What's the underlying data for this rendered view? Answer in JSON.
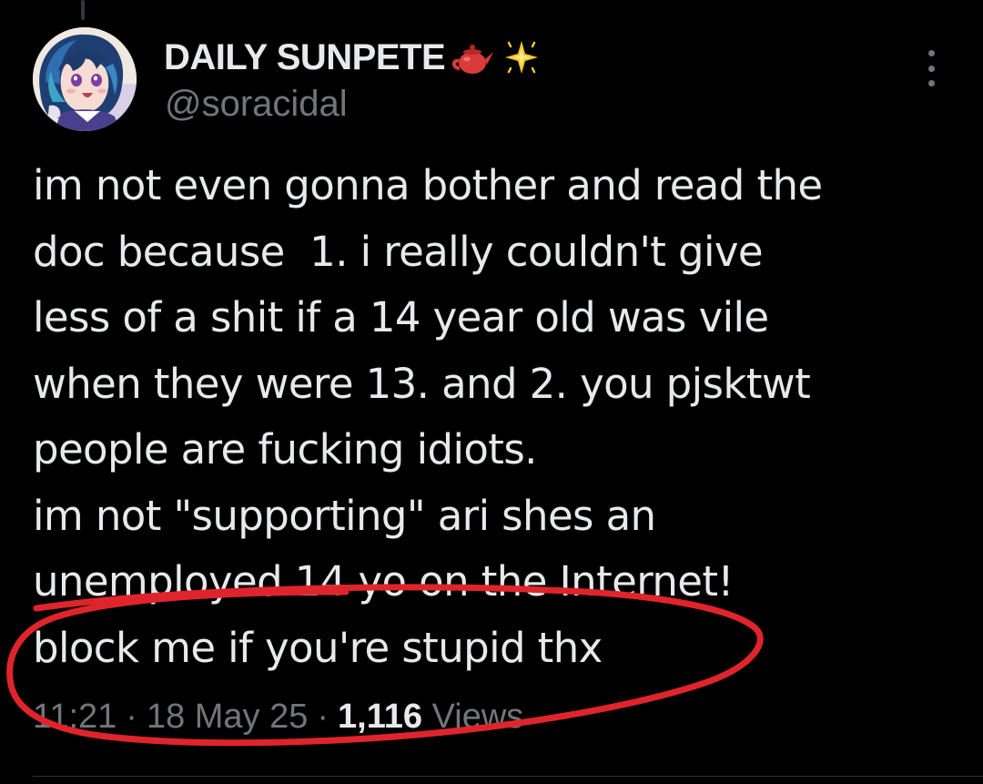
{
  "author": {
    "display_name": "DAILY SUNPETE",
    "name_emojis": [
      "teapot-emoji",
      "sparkle-star-emoji"
    ],
    "handle": "@soracidal",
    "avatar": "anime-avatar"
  },
  "tweet": {
    "lines": [
      "im not even gonna bother and read the",
      "doc because  1. i really couldn't give",
      "less of a shit if a 14 year old was vile",
      "when they were 13. and 2. you pjsktwt",
      "people are fucking idiots.",
      "im not \"supporting\" ari shes an",
      "unemployed 14 yo on the Internet!",
      "block me if you're stupid thx"
    ]
  },
  "meta": {
    "time": "11:21",
    "separator": "·",
    "date": "18 May 25",
    "views_count": "1,116",
    "views_label": "Views"
  },
  "icons": {
    "more": "more-vertical-icon"
  },
  "colors": {
    "background": "#000000",
    "primary_text": "#e7e9ea",
    "secondary_text": "#71767b",
    "annotation_stroke": "#e0242b"
  }
}
